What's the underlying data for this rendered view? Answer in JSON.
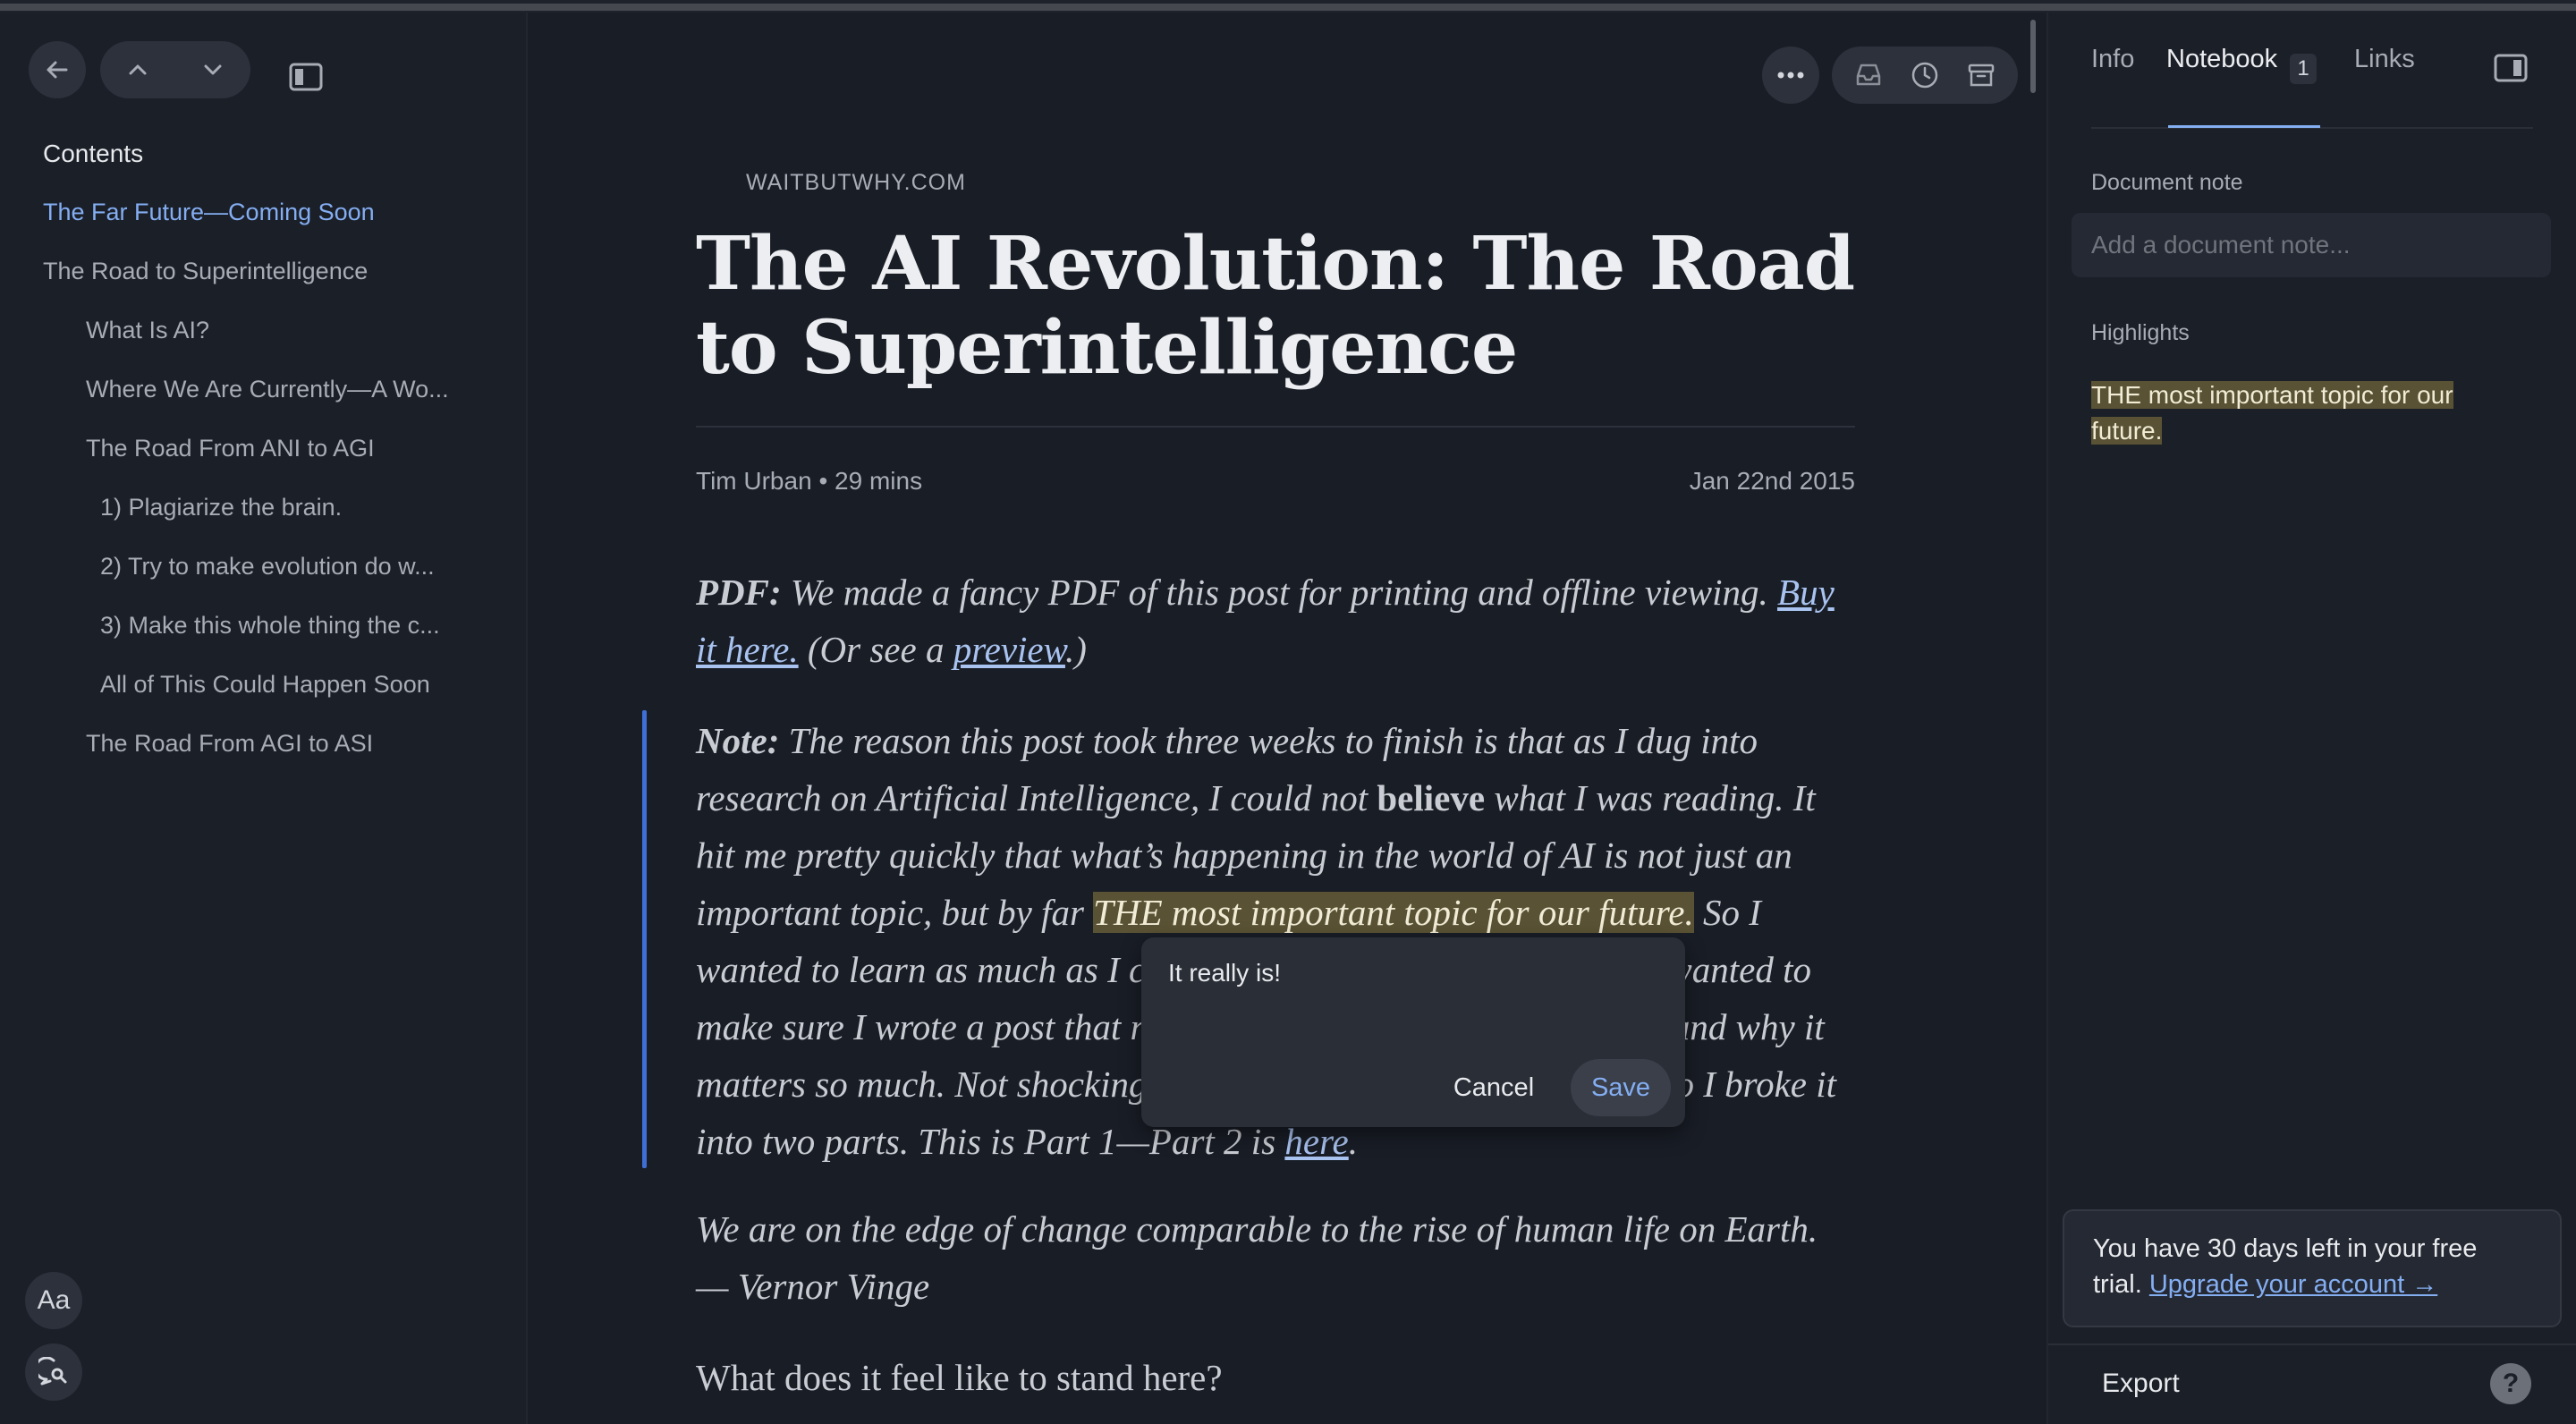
{
  "sidebar": {
    "contents_title": "Contents",
    "toc": [
      {
        "label": "The Far Future—Coming Soon",
        "level": 0,
        "active": true
      },
      {
        "label": "The Road to Superintelligence",
        "level": 0,
        "active": false
      },
      {
        "label": "What Is AI?",
        "level": 1,
        "active": false
      },
      {
        "label": "Where We Are Currently—A Wo...",
        "level": 1,
        "active": false
      },
      {
        "label": "The Road From ANI to AGI",
        "level": 1,
        "active": false
      },
      {
        "label": "1) Plagiarize the brain.",
        "level": 2,
        "active": false
      },
      {
        "label": "2) Try to make evolution do w...",
        "level": 2,
        "active": false
      },
      {
        "label": "3) Make this whole thing the c...",
        "level": 2,
        "active": false
      },
      {
        "label": "All of This Could Happen Soon",
        "level": 2,
        "active": false
      },
      {
        "label": "The Road From AGI to ASI",
        "level": 1,
        "active": false
      }
    ],
    "font_button_label": "Aa"
  },
  "article": {
    "site": "WAITBUTWHY.COM",
    "title": "The AI Revolution: The Road to Superintelligence",
    "author": "Tim Urban",
    "bullet": "•",
    "read_time": "29 mins",
    "date": "Jan 22nd 2015",
    "p1": {
      "lead": "PDF:",
      "text": " We made a fancy PDF of this post for printing and offline viewing. ",
      "link1": "Buy it here.",
      "mid": " (Or see a ",
      "link2": "preview",
      "end": ".)"
    },
    "p2": {
      "lead": "Note:",
      "t1": " The reason this post took three weeks to finish is that as I dug into research on Artificial Intelligence, I could not ",
      "bold": "believe",
      "t2": " what I was reading. It hit me pretty quickly that what’s happening in the world of AI is not just an important topic, but by far ",
      "highlight": "THE most important topic for our future.",
      "t3": " So I wanted to learn as much as I could about it, and once I did that, I wanted to make sure I wrote a post that really explained this whole situation and why it matters so much. Not shockingly, that became outrageously long, so I broke it into two parts. This is Part 1—Part 2 is ",
      "link": "here",
      "end": "."
    },
    "p3": {
      "italic": "We are on the edge of change comparable to the rise of human life on Earth.",
      "attrib": " — Vernor Vinge"
    },
    "p4": "What does it feel like to stand here?"
  },
  "popover": {
    "note_text": "It really is!",
    "cancel_label": "Cancel",
    "save_label": "Save"
  },
  "right_panel": {
    "tabs": [
      "Info",
      "Notebook",
      "Links"
    ],
    "active_tab": "Notebook",
    "notebook_count": "1",
    "document_note_label": "Document note",
    "document_note_placeholder": "Add a document note...",
    "highlights_label": "Highlights",
    "highlight_text": "THE most important topic for our future.",
    "trial_text": "You have 30 days left in your free trial. ",
    "trial_link": "Upgrade your account →",
    "export_label": "Export",
    "help_label": "?"
  },
  "colors": {
    "background": "#191d26",
    "accent": "#84aef2",
    "highlight": "#5a5234",
    "quote_bar": "#3e6fd6"
  },
  "icons": [
    "back-arrow-icon",
    "chevron-up-icon",
    "chevron-down-icon",
    "sidebar-toggle-icon",
    "more-dots-icon",
    "inbox-icon",
    "later-clock-icon",
    "archive-icon",
    "right-panel-toggle-icon",
    "chat-search-icon"
  ]
}
